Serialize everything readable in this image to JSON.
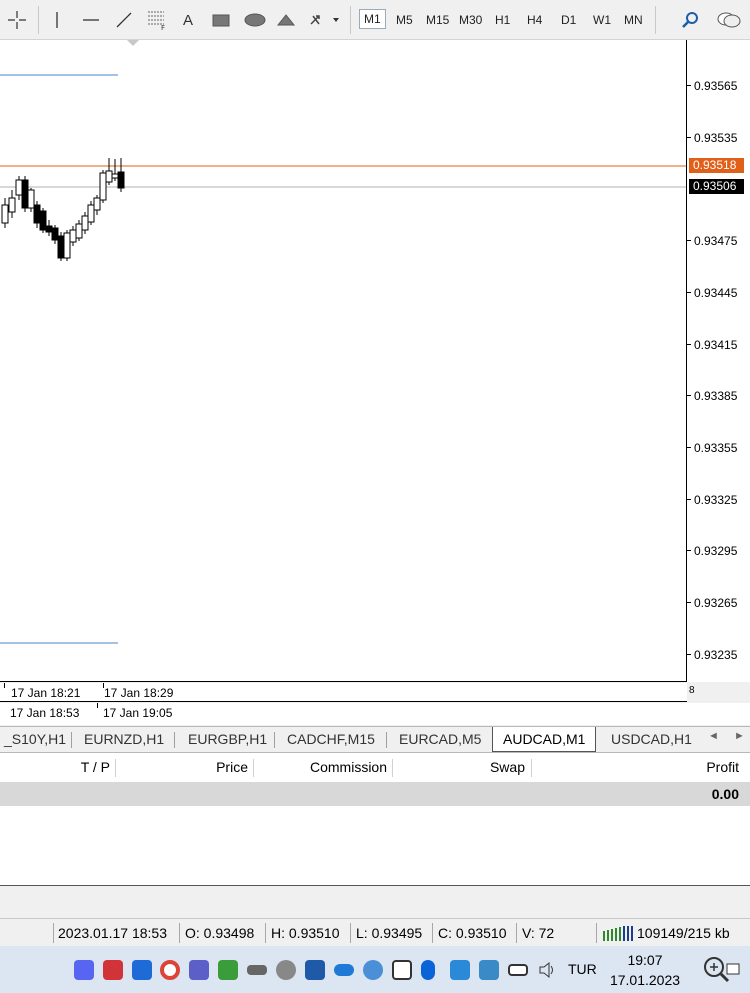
{
  "toolbar": {
    "text_tool": "A",
    "timeframes": [
      "M1",
      "M5",
      "M15",
      "M30",
      "H1",
      "H4",
      "D1",
      "W1",
      "MN"
    ],
    "active_timeframe": "M1"
  },
  "chart": {
    "symbol": "AUDCAD",
    "timeframe": "M1",
    "price_levels": [
      "0.93565",
      "0.93535",
      "0.93475",
      "0.93445",
      "0.93415",
      "0.93385",
      "0.93355",
      "0.93325",
      "0.93295",
      "0.93265",
      "0.93235"
    ],
    "ask_tag": "0.93518",
    "bid_tag": "0.93506",
    "ask_color": "#e0601a",
    "bid_color": "#000000",
    "time_labels_row1": [
      "17 Jan 18:21",
      "17 Jan 18:29"
    ],
    "time_labels_row2": [
      "17 Jan 18:53",
      "17 Jan 19:05"
    ],
    "axis_marker": "8"
  },
  "tabs": {
    "items": [
      "_S10Y,H1",
      "EURNZD,H1",
      "EURGBP,H1",
      "CADCHF,M15",
      "EURCAD,M5",
      "AUDCAD,M1",
      "USDCAD,H1"
    ],
    "active": "AUDCAD,M1",
    "scroll_left": "◄",
    "scroll_right": "►"
  },
  "terminal": {
    "columns": [
      "T / P",
      "Price",
      "Commission",
      "Swap",
      "Profit"
    ],
    "summary_profit": "0.00"
  },
  "statusbar": {
    "datetime": "2023.01.17 18:53",
    "open": "O: 0.93498",
    "high": "H: 0.93510",
    "low": "L: 0.93495",
    "close": "C: 0.93510",
    "volume": "V: 72",
    "traffic": "109149/215 kb"
  },
  "taskbar": {
    "language": "TUR",
    "time": "19:07",
    "date": "17.01.2023"
  }
}
